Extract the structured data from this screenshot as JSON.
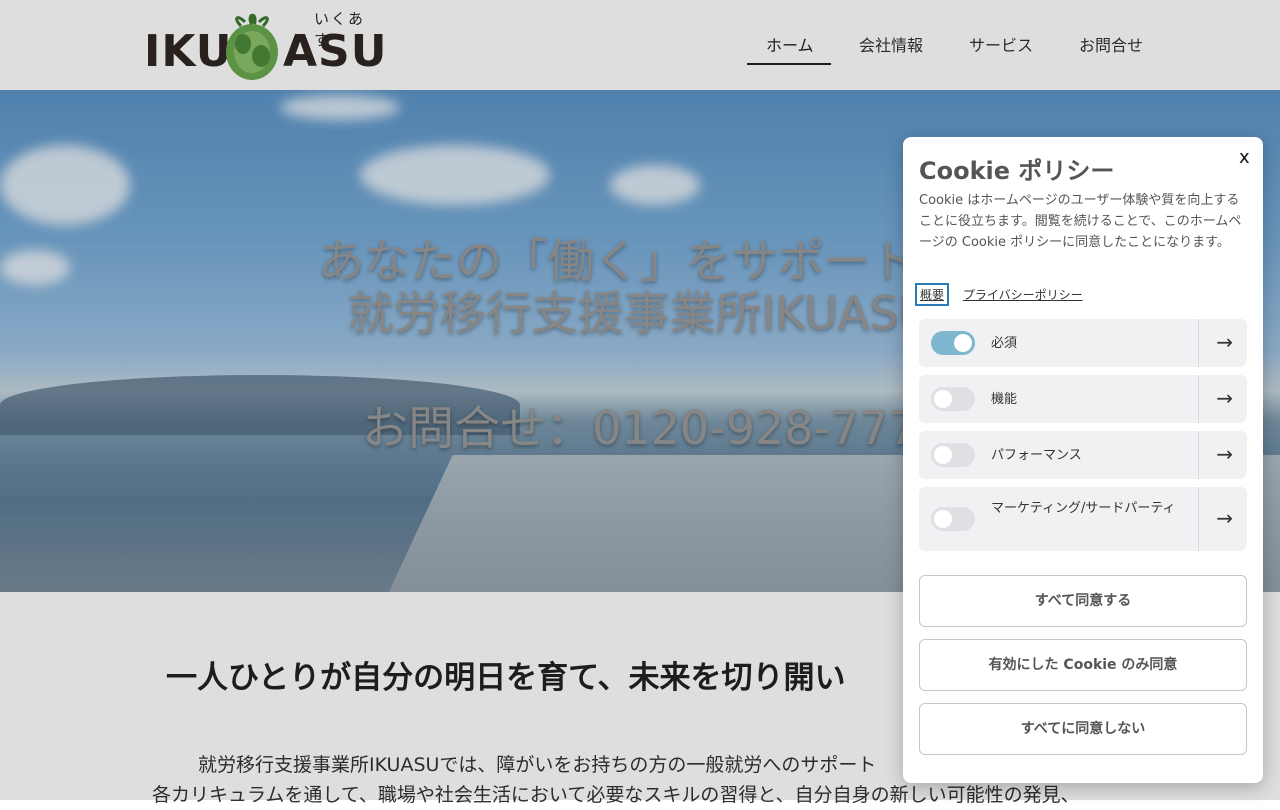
{
  "header": {
    "logo_text_left": "IKU",
    "logo_text_right": "ASU",
    "logo_ruby": "いくあす",
    "nav": [
      "ホーム",
      "会社情報",
      "サービス",
      "お問合せ"
    ]
  },
  "hero": {
    "title_line1": "あなたの「働く」をサポートし",
    "title_line2": "就労移行支援事業所IKUASU",
    "phone": "お問合せ：0120-928-777"
  },
  "content": {
    "heading": "一人ひとりが自分の明日を育て、未来を切り開い",
    "para_line1": "就労移行支援事業所IKUASUでは、障がいをお持ちの方の一般就労へのサポート",
    "para_line2": "各カリキュラムを通して、職場や社会生活において必要なスキルの習得と、自分自身の新しい可能性の発見、"
  },
  "cookie": {
    "title": "Cookie ポリシー",
    "close": "x",
    "description": "Cookie はホームページのユーザー体験や質を向上することに役立ちます。閲覧を続けることで、このホームページの Cookie ポリシーに同意したことになります。",
    "link_summary": "概要",
    "link_privacy": "プライバシーポリシー",
    "categories": [
      {
        "label": "必須",
        "enabled": true
      },
      {
        "label": "機能",
        "enabled": false
      },
      {
        "label": "パフォーマンス",
        "enabled": false
      },
      {
        "label": "マーケティング/サードパーティ",
        "enabled": false
      }
    ],
    "buttons": {
      "accept_all": "すべて同意する",
      "accept_selected": "有効にした Cookie のみ同意",
      "reject_all": "すべてに同意しない"
    }
  }
}
